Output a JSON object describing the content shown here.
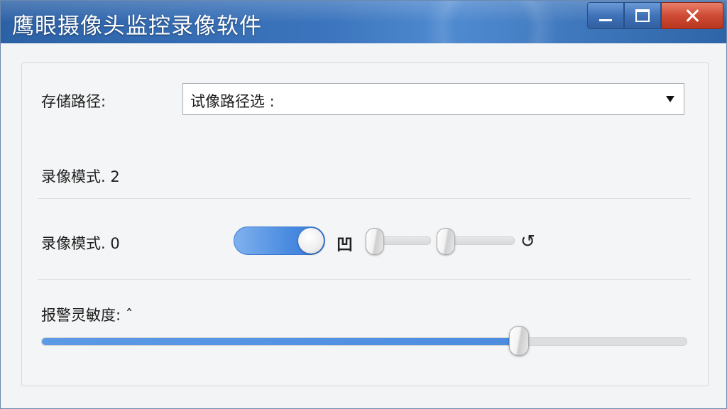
{
  "window": {
    "title": "鹰眼摄像头监控录像软件",
    "buttons": {
      "minimize": "minimize",
      "maximize": "maximize",
      "close": "close"
    }
  },
  "storage": {
    "label": "存储路径:",
    "value": "试像路径选 :",
    "dropdown_icon": "triangle-down-icon"
  },
  "record_mode_1": {
    "label": "录像模式. 2"
  },
  "record_mode_2": {
    "label": "录像模式. 0",
    "toggle_on": true,
    "glyph": "凹",
    "slider_a_value": 0.0,
    "slider_b_value": 0.0,
    "refresh_icon": "refresh-icon",
    "refresh_glyph": "↺"
  },
  "sensitivity": {
    "label": "报警灵敏度: ˆ",
    "value": 0.74
  },
  "colors": {
    "accent": "#4a8be0",
    "titlebar": "#3c75bd",
    "close_button": "#cf4b35"
  }
}
